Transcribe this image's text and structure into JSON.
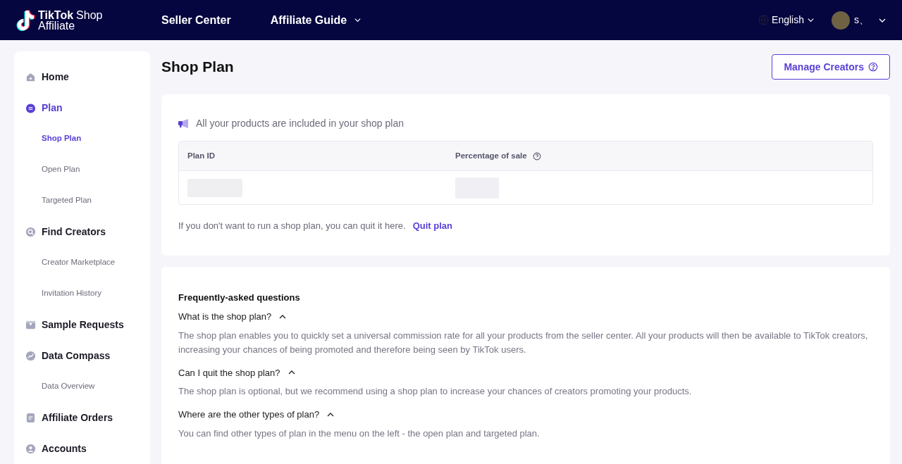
{
  "header": {
    "logo": {
      "brand": "TikTok",
      "product": "Shop",
      "sub": "Affiliate"
    },
    "nav": [
      {
        "label": "Seller Center",
        "dropdown": false
      },
      {
        "label": "Affiliate Guide",
        "dropdown": true
      }
    ],
    "language": "English",
    "user": "s、"
  },
  "sidebar": {
    "items": [
      {
        "label": "Home",
        "selected": false
      },
      {
        "label": "Plan",
        "selected": true,
        "children": [
          {
            "label": "Shop Plan",
            "selected": true
          },
          {
            "label": "Open Plan",
            "selected": false
          },
          {
            "label": "Targeted Plan",
            "selected": false
          }
        ]
      },
      {
        "label": "Find Creators",
        "selected": false,
        "children": [
          {
            "label": "Creator Marketplace",
            "selected": false
          },
          {
            "label": "Invitation History",
            "selected": false
          }
        ]
      },
      {
        "label": "Sample Requests",
        "selected": false
      },
      {
        "label": "Data Compass",
        "selected": false,
        "children": [
          {
            "label": "Data Overview",
            "selected": false
          }
        ]
      },
      {
        "label": "Affiliate Orders",
        "selected": false
      },
      {
        "label": "Accounts",
        "selected": false
      }
    ]
  },
  "page": {
    "title": "Shop Plan",
    "action": "Manage Creators"
  },
  "plan_card": {
    "notice": "All your products are included in your shop plan",
    "table": {
      "columns": [
        "Plan ID",
        "Percentage of sale"
      ]
    },
    "quit_text": "If you don't want to run a shop plan, you can quit it here.",
    "quit_link": "Quit plan"
  },
  "faq": {
    "title": "Frequently-asked questions",
    "items": [
      {
        "question": "What is the shop plan?",
        "expanded": true,
        "answer": "The shop plan enables you to quickly set a universal commission rate for all your products from the seller center. All your products will then be available to TikTok creators, increasing your chances of being promoted and therefore being seen by TikTok users."
      },
      {
        "question": "Can I quit the shop plan?",
        "expanded": true,
        "answer": "The shop plan is optional, but we recommend using a shop plan to increase your chances of creators promoting your products."
      },
      {
        "question": "Where are the other types of plan?",
        "expanded": true,
        "answer": "You can find other types of plan in the menu on the left - the open plan and targeted plan."
      }
    ]
  }
}
